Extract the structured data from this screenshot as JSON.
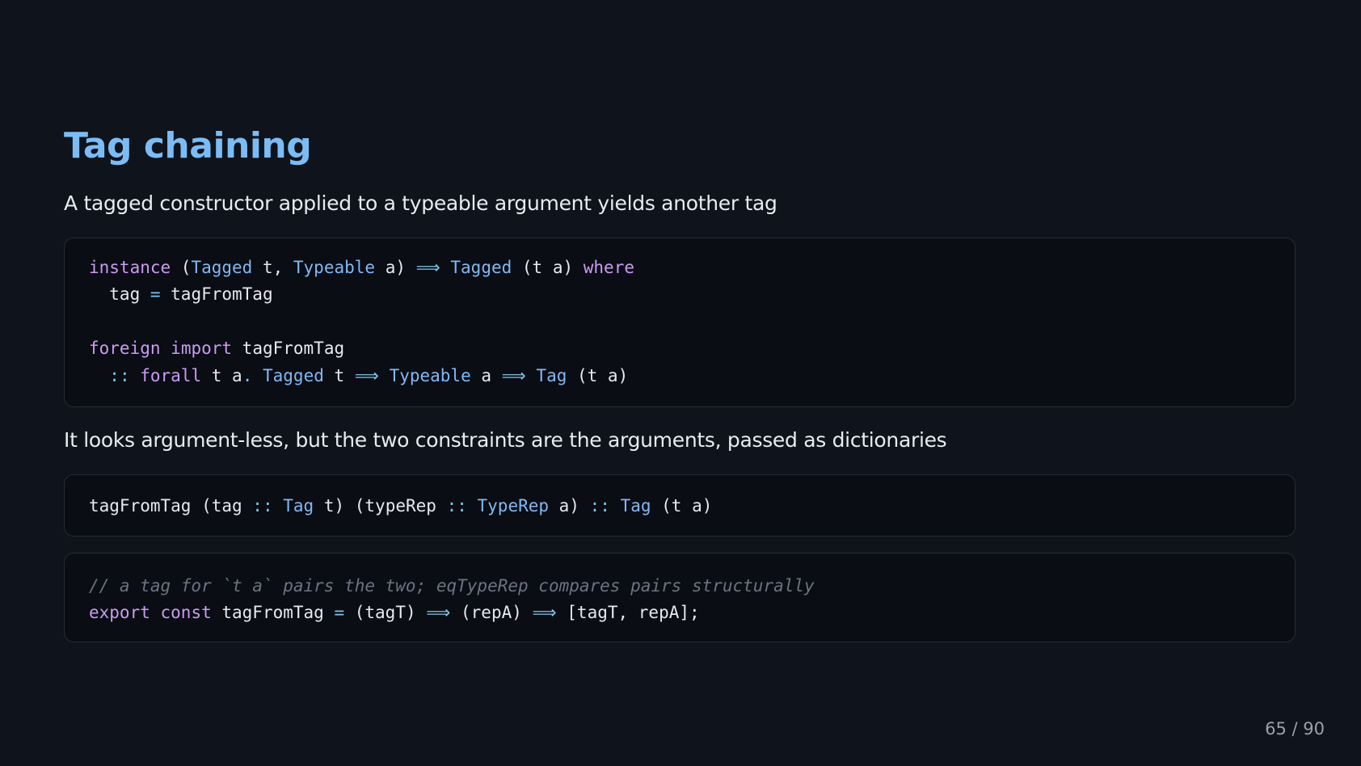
{
  "slide": {
    "title": "Tag chaining",
    "intro": "A tagged constructor applied to a typeable argument yields another tag",
    "explanation": "It looks argument-less, but the two constraints are the arguments, passed as dictionaries",
    "page_indicator": "65 / 90"
  },
  "code_blocks": [
    {
      "language": "haskell",
      "lines": [
        [
          {
            "cls": "kw",
            "text": "instance"
          },
          {
            "cls": "id",
            "text": " ("
          },
          {
            "cls": "ty",
            "text": "Tagged"
          },
          {
            "cls": "id",
            "text": " t, "
          },
          {
            "cls": "ty",
            "text": "Typeable"
          },
          {
            "cls": "id",
            "text": " a) "
          },
          {
            "cls": "op",
            "text": "⟹"
          },
          {
            "cls": "id",
            "text": " "
          },
          {
            "cls": "ty",
            "text": "Tagged"
          },
          {
            "cls": "id",
            "text": " (t a) "
          },
          {
            "cls": "kw",
            "text": "where"
          }
        ],
        [
          {
            "cls": "id",
            "text": "  tag "
          },
          {
            "cls": "op",
            "text": "="
          },
          {
            "cls": "id",
            "text": " tagFromTag"
          }
        ],
        [],
        [
          {
            "cls": "kw",
            "text": "foreign"
          },
          {
            "cls": "id",
            "text": " "
          },
          {
            "cls": "kw",
            "text": "import"
          },
          {
            "cls": "id",
            "text": " tagFromTag"
          }
        ],
        [
          {
            "cls": "id",
            "text": "  "
          },
          {
            "cls": "op",
            "text": "::"
          },
          {
            "cls": "id",
            "text": " "
          },
          {
            "cls": "kw",
            "text": "forall"
          },
          {
            "cls": "id",
            "text": " t a"
          },
          {
            "cls": "op",
            "text": "."
          },
          {
            "cls": "id",
            "text": " "
          },
          {
            "cls": "ty",
            "text": "Tagged"
          },
          {
            "cls": "id",
            "text": " t "
          },
          {
            "cls": "op",
            "text": "⟹"
          },
          {
            "cls": "id",
            "text": " "
          },
          {
            "cls": "ty",
            "text": "Typeable"
          },
          {
            "cls": "id",
            "text": " a "
          },
          {
            "cls": "op",
            "text": "⟹"
          },
          {
            "cls": "id",
            "text": " "
          },
          {
            "cls": "ty",
            "text": "Tag"
          },
          {
            "cls": "id",
            "text": " (t a)"
          }
        ]
      ]
    },
    {
      "language": "haskell",
      "lines": [
        [
          {
            "cls": "id",
            "text": "tagFromTag (tag "
          },
          {
            "cls": "op",
            "text": "::"
          },
          {
            "cls": "id",
            "text": " "
          },
          {
            "cls": "ty",
            "text": "Tag"
          },
          {
            "cls": "id",
            "text": " t) (typeRep "
          },
          {
            "cls": "op",
            "text": "::"
          },
          {
            "cls": "id",
            "text": " "
          },
          {
            "cls": "ty",
            "text": "TypeRep"
          },
          {
            "cls": "id",
            "text": " a) "
          },
          {
            "cls": "op",
            "text": "::"
          },
          {
            "cls": "id",
            "text": " "
          },
          {
            "cls": "ty",
            "text": "Tag"
          },
          {
            "cls": "id",
            "text": " (t a)"
          }
        ]
      ]
    },
    {
      "language": "javascript",
      "lines": [
        [
          {
            "cls": "cm",
            "text": "// a tag for `t a` pairs the two; eqTypeRep compares pairs structurally"
          }
        ],
        [
          {
            "cls": "kw",
            "text": "export"
          },
          {
            "cls": "id",
            "text": " "
          },
          {
            "cls": "kw",
            "text": "const"
          },
          {
            "cls": "id",
            "text": " tagFromTag "
          },
          {
            "cls": "op",
            "text": "="
          },
          {
            "cls": "id",
            "text": " (tagT) "
          },
          {
            "cls": "op",
            "text": "⟹"
          },
          {
            "cls": "id",
            "text": " (repA) "
          },
          {
            "cls": "op",
            "text": "⟹"
          },
          {
            "cls": "id",
            "text": " [tagT, repA];"
          }
        ]
      ]
    }
  ],
  "colors": {
    "background": "#0f131b",
    "title": "#7bbcf5",
    "keyword": "#cb9bf0",
    "type": "#82b8f2",
    "operator": "#7fc4e8",
    "comment": "#6c7380"
  }
}
